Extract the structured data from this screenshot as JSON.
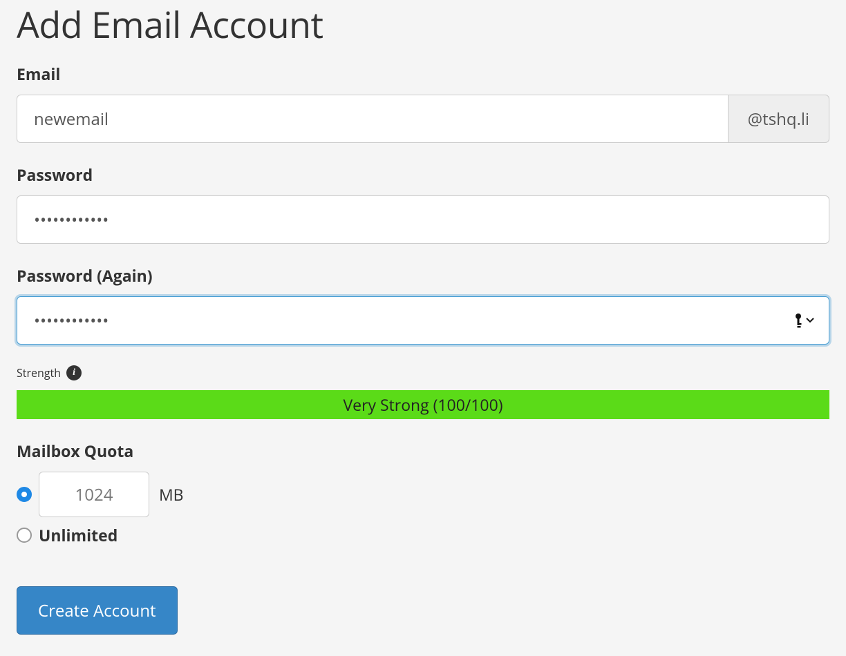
{
  "page": {
    "title": "Add Email Account"
  },
  "email": {
    "label": "Email",
    "value": "newemail",
    "domain_suffix": "@tshq.li"
  },
  "password": {
    "label": "Password",
    "value": "••••••••••••"
  },
  "password_again": {
    "label": "Password (Again)",
    "value": "••••••••••••"
  },
  "strength": {
    "label": "Strength",
    "bar_text": "Very Strong (100/100)"
  },
  "quota": {
    "label": "Mailbox Quota",
    "fixed_value": "1024",
    "unit": "MB",
    "unlimited_label": "Unlimited"
  },
  "actions": {
    "create_label": "Create Account"
  }
}
